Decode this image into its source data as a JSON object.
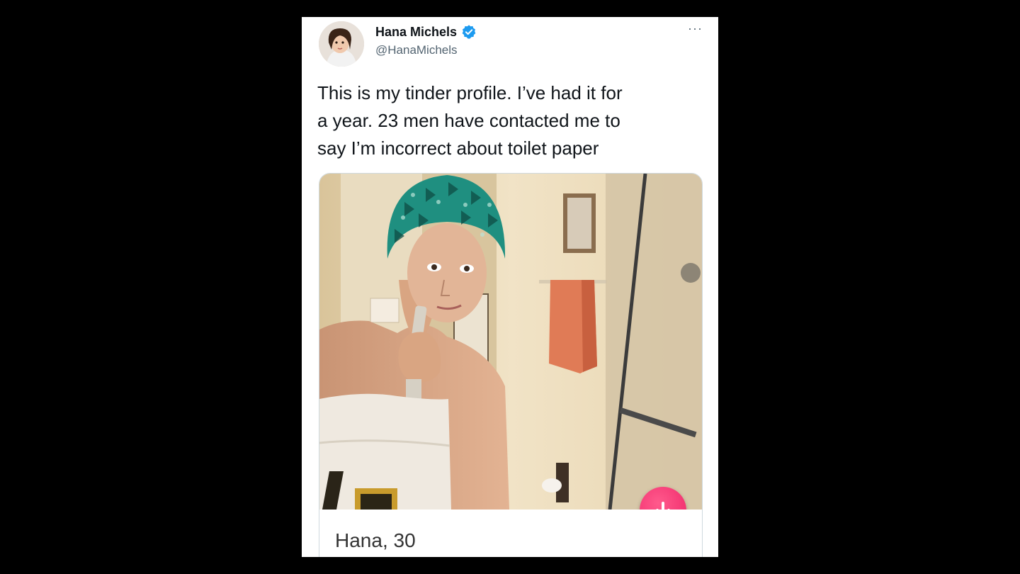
{
  "tweet": {
    "display_name": "Hana Michels",
    "handle": "@HanaMichels",
    "more_label": "···",
    "text": "This is my tinder profile. I’ve had it for\na year. 23 men have contacted me to\nsay I’m incorrect about toilet paper",
    "verified_icon": "verified-badge-icon",
    "accent_color": "#1d9bf0"
  },
  "media": {
    "profile_caption": "Hana, 30",
    "action_icon": "arrow-down-icon",
    "action_color": "#ee2266"
  }
}
